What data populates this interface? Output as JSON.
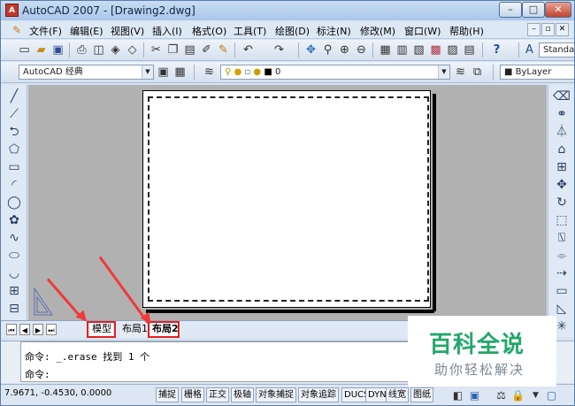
{
  "window": {
    "title": "AutoCAD 2007 - [Drawing2.dwg]",
    "min": "–",
    "max": "□",
    "close": "✕"
  },
  "menu": {
    "items": [
      "文件(F)",
      "编辑(E)",
      "视图(V)",
      "插入(I)",
      "格式(O)",
      "工具(T)",
      "绘图(D)",
      "标注(N)",
      "修改(M)",
      "窗口(W)",
      "帮助(H)"
    ],
    "doc_min": "–",
    "doc_restore": "▫",
    "doc_close": "✕"
  },
  "toolbar1": {
    "text_style": "Standa"
  },
  "toolbar2": {
    "workspace": "AutoCAD 经典",
    "layer": "0",
    "color": "ByLayer"
  },
  "layout_tabs": {
    "model": "模型",
    "layout1": "布局1",
    "layout2": "布局2"
  },
  "command": {
    "line1": "命令: _.erase 找到 1 个",
    "line2": "命令:"
  },
  "status": {
    "coords": "7.9671, -0.4530, 0.0000",
    "buttons": [
      "捕捉",
      "栅格",
      "正交",
      "极轴",
      "对象捕捉",
      "对象追踪",
      "DUCS",
      "DYN",
      "线宽",
      "图纸"
    ]
  },
  "watermark": {
    "title": "百科全说",
    "subtitle": "助你轻松解决"
  },
  "colors": {
    "annotation": "#e02020",
    "paper_border": "#000000",
    "canvas": "#b1b1b1",
    "watermark_green": "#22a86a"
  }
}
